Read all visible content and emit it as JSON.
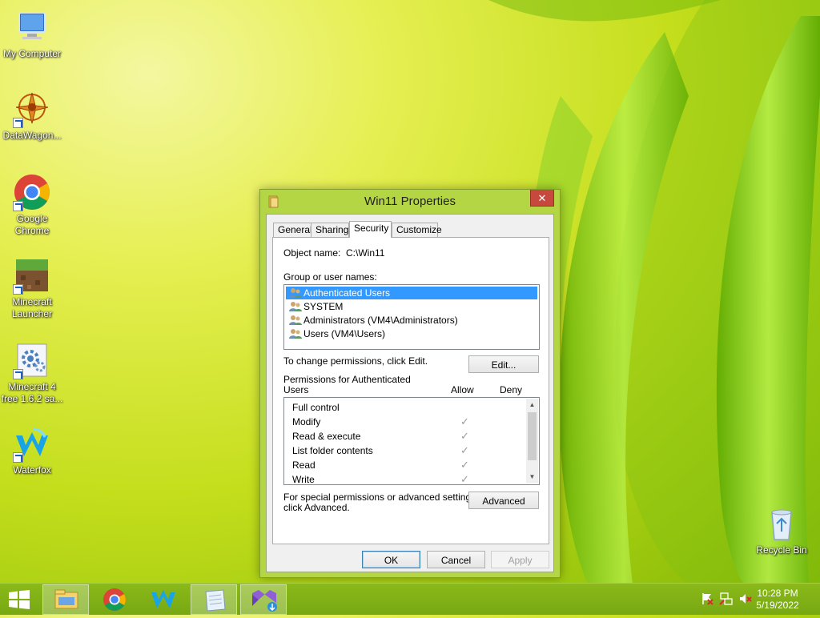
{
  "desktop": {
    "icons": [
      {
        "label": "My Computer"
      },
      {
        "label": "DataWagon..."
      },
      {
        "label": "Google Chrome"
      },
      {
        "label": "Minecraft Launcher"
      },
      {
        "label": "Minecraft 4 free 1.6.2 sa..."
      },
      {
        "label": "Waterfox"
      },
      {
        "label": "Recycle Bin"
      }
    ]
  },
  "dialog": {
    "title": "Win11 Properties",
    "close_glyph": "✕",
    "tabs": [
      {
        "label": "General"
      },
      {
        "label": "Sharing"
      },
      {
        "label": "Security",
        "active": true
      },
      {
        "label": "Customize"
      }
    ],
    "object_name_label": "Object name:",
    "object_name_value": "C:\\Win11",
    "groups_label": "Group or user names:",
    "groups": [
      {
        "name": "Authenticated Users",
        "selected": true
      },
      {
        "name": "SYSTEM"
      },
      {
        "name": "Administrators (VM4\\Administrators)"
      },
      {
        "name": "Users (VM4\\Users)"
      }
    ],
    "change_hint": "To change permissions, click Edit.",
    "edit_button": "Edit...",
    "permissions_label_line1": "Permissions for Authenticated",
    "permissions_label_line2": "Users",
    "allow_header": "Allow",
    "deny_header": "Deny",
    "permissions": [
      {
        "name": "Full control",
        "allow": false
      },
      {
        "name": "Modify",
        "allow": true
      },
      {
        "name": "Read & execute",
        "allow": true
      },
      {
        "name": "List folder contents",
        "allow": true
      },
      {
        "name": "Read",
        "allow": true
      },
      {
        "name": "Write",
        "allow": true
      }
    ],
    "check_glyph": "✓",
    "advanced_hint_line1": "For special permissions or advanced settings,",
    "advanced_hint_line2": "click Advanced.",
    "advanced_button": "Advanced",
    "ok_button": "OK",
    "cancel_button": "Cancel",
    "apply_button": "Apply"
  },
  "taskbar": {
    "time": "10:28 PM",
    "date": "5/19/2022"
  },
  "colors": {
    "selection": "#3399ff",
    "dialog_frame": "#b4d645",
    "close_button": "#c7483c"
  }
}
